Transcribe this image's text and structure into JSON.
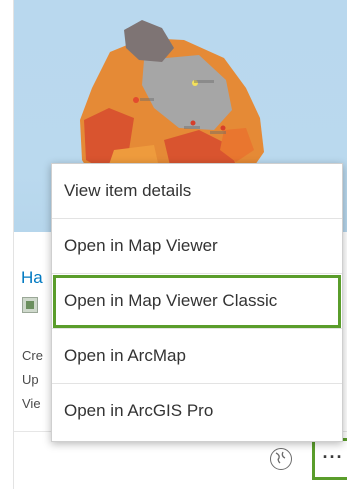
{
  "card": {
    "title_partial": "Ha",
    "meta_lines": [
      "Cre",
      "Up",
      "Vie"
    ]
  },
  "menu": {
    "items": [
      {
        "label": "View item details"
      },
      {
        "label": "Open in Map Viewer"
      },
      {
        "label": "Open in Map Viewer Classic",
        "highlighted": true
      },
      {
        "label": "Open in ArcMap"
      },
      {
        "label": "Open in ArcGIS Pro"
      }
    ]
  },
  "actions": {
    "more_label": "···",
    "more_icon": "ellipsis-icon",
    "globe_icon": "globe-icon"
  },
  "colors": {
    "accent_highlight": "#5a9d2b",
    "title_link": "#0079c1",
    "map_water": "#b9d8ee"
  }
}
